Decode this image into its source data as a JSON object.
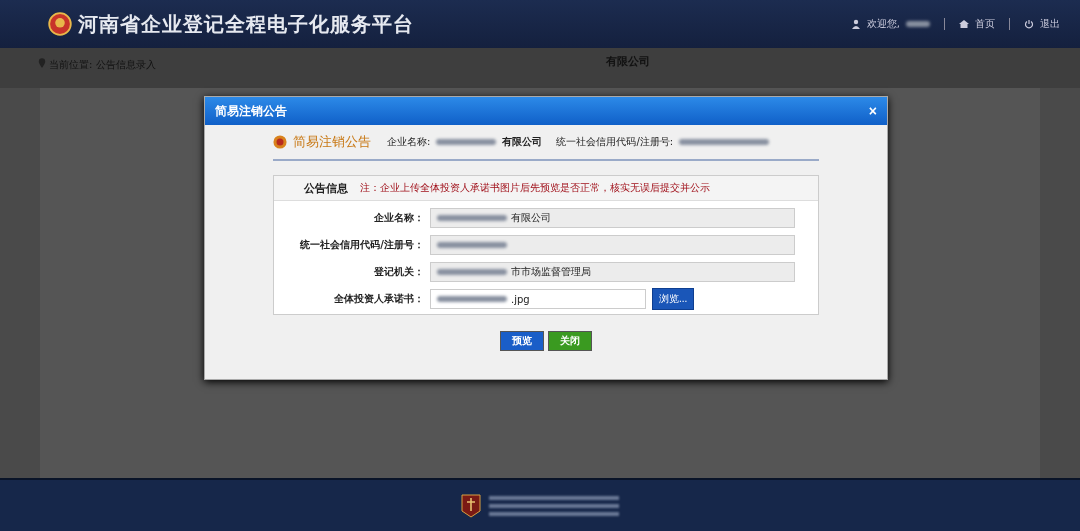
{
  "header": {
    "title": "河南省企业登记全程电子化服务平台",
    "welcome": "欢迎您,",
    "links": [
      "首页",
      "退出"
    ]
  },
  "breadcrumb": "当前位置: 公告信息录入",
  "background_company": "有限公司",
  "dialog": {
    "title": "简易注销公告",
    "close": "×",
    "heading": "简易注销公告",
    "company_label": "企业名称:",
    "company_value": "有限公司",
    "code_label": "统一社会信用代码/注册号:",
    "section_title": "公告信息",
    "notice": "注：企业上传全体投资人承诺书图片后先预览是否正常，核实无误后提交并公示",
    "fields": [
      {
        "label": "企业名称：",
        "value": "有限公司",
        "kind": "readonly"
      },
      {
        "label": "统一社会信用代码/注册号：",
        "kind": "readonly"
      },
      {
        "label": "登记机关：",
        "value": "市市场监督管理局",
        "kind": "readonly"
      },
      {
        "label": "全体投资人承诺书：",
        "value": ".jpg",
        "kind": "file",
        "button": "浏览..."
      }
    ],
    "buttons": [
      {
        "label": "预览",
        "kind": "primary"
      },
      {
        "label": "关闭",
        "kind": "success"
      }
    ]
  }
}
